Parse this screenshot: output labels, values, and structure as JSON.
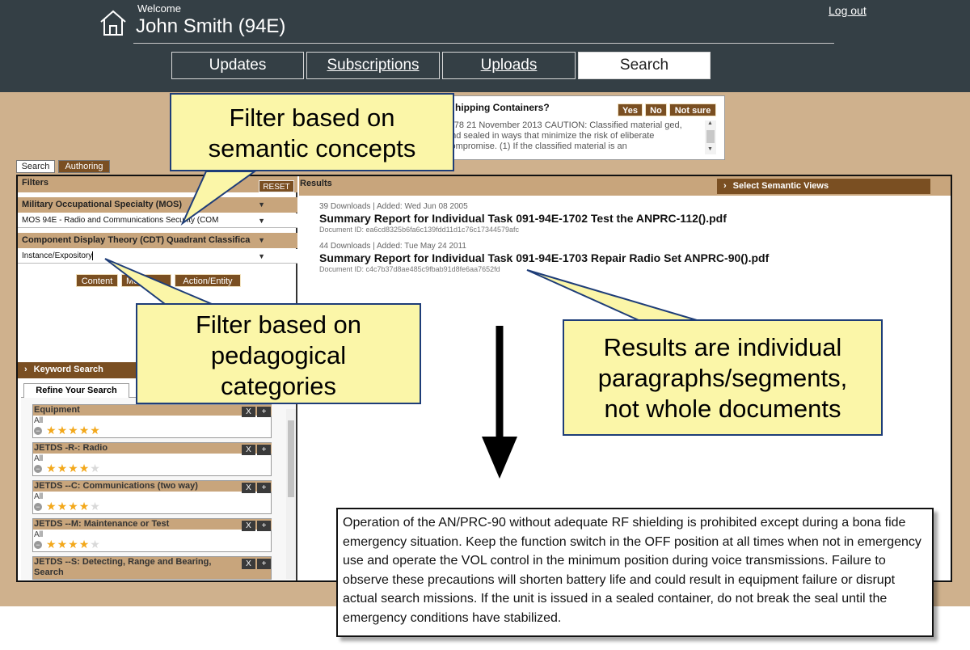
{
  "header": {
    "welcome": "Welcome",
    "user_name": "John Smith (94E)",
    "logout": "Log out",
    "tabs": [
      {
        "label": "Updates"
      },
      {
        "label": "Subscriptions"
      },
      {
        "label": "Uploads"
      },
      {
        "label": "Search"
      }
    ]
  },
  "popup": {
    "question": "hipping Containers?",
    "buttons": [
      "Yes",
      "No",
      "Not sure"
    ],
    "text": "-278 21 November 2013 CAUTION: Classified material ged, and sealed in ways that minimize the risk of eliberate compromise. (1) If the classified material is an"
  },
  "mode_tabs": [
    "Search",
    "Authoring"
  ],
  "filters": {
    "title": "Filters",
    "reset": "RESET",
    "mos_label": "Military Occupational Specialty (MOS)",
    "mos_value": "MOS 94E - Radio and Communications Security (COM",
    "cdt_label": "Component Display Theory (CDT) Quadrant Classifica",
    "cdt_value": "Instance/Expository",
    "category_buttons": [
      "Content",
      "Me",
      "Action/Entity"
    ]
  },
  "keyword_search": "Keyword Search",
  "refine": {
    "tab": "Refine Your Search",
    "facets": [
      {
        "title": "Equipment",
        "value": "All",
        "rating": 5
      },
      {
        "title": "JETDS -R-: Radio",
        "value": "All",
        "rating": 4
      },
      {
        "title": "JETDS --C: Communications (two way)",
        "value": "All",
        "rating": 4
      },
      {
        "title": "JETDS --M: Maintenance or Test",
        "value": "All",
        "rating": 4
      },
      {
        "title": "JETDS --S: Detecting, Range and Bearing,",
        "value": "Search",
        "rating": 0
      }
    ],
    "x": "X",
    "plus": "+"
  },
  "results": {
    "title": "Results",
    "semantic_views": "Select Semantic Views",
    "items": [
      {
        "meta": "39 Downloads  |  Added: Wed Jun 08 2005",
        "title": "Summary Report for Individual Task 091-94E-1702 Test the ANPRC-112().pdf",
        "id": "Document ID: ea6cd8325b6fa6c139fdd11d1c76c17344579afc"
      },
      {
        "meta": "44 Downloads  |  Added: Tue May 24 2011",
        "title": "Summary Report for Individual Task 091-94E-1703 Repair Radio Set ANPRC-90().pdf",
        "id": "Document ID: c4c7b37d8ae485c9fbab91d8fe6aa7652fd"
      }
    ]
  },
  "callouts": {
    "semantic": [
      "Filter based on",
      "semantic concepts"
    ],
    "pedagogical": [
      "Filter based on",
      "pedagogical",
      "categories"
    ],
    "results": [
      "Results are individual",
      "paragraphs/segments,",
      "not whole documents"
    ]
  },
  "paragraph": "Operation of the AN/PRC-90 without adequate RF shielding is prohibited except during a bona fide emergency situation. Keep the function switch in the OFF position at all times when not in emergency use and operate the VOL control in the minimum position during voice transmissions. Failure to observe these precautions will shorten battery life and could result in equipment failure or disrupt actual search missions. If the unit is issued in a sealed container, do not break the seal until the emergency conditions have stabilized.",
  "colors": {
    "header": "#343f45",
    "background": "#cfb18d",
    "bar": "#c8a57c",
    "button": "#7a4f22",
    "callout": "#fbf6a8",
    "callout_border": "#1e3d78",
    "star": "#f3a81b"
  }
}
